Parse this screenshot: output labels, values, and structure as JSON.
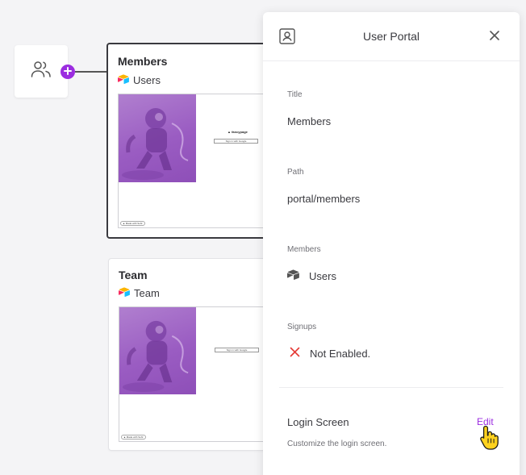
{
  "cards": [
    {
      "title": "Members",
      "source": "Users",
      "preview_logo": "▲ fancypage",
      "preview_button": "Sign in with Google",
      "preview_badge": "▲ Made with Softr"
    },
    {
      "title": "Team",
      "source": "Team",
      "preview_logo": "",
      "preview_button": "Sign in with Google",
      "preview_badge": "▲ Made with Softr"
    }
  ],
  "panel": {
    "title": "User Portal",
    "fields": {
      "title_label": "Title",
      "title_value": "Members",
      "path_label": "Path",
      "path_value": "portal/members",
      "members_label": "Members",
      "members_value": "Users",
      "signups_label": "Signups",
      "signups_value": "Not Enabled."
    },
    "login": {
      "title": "Login Screen",
      "edit_label": "Edit",
      "description": "Customize the login screen."
    }
  },
  "colors": {
    "accent": "#9b2de0",
    "disabled_x": "#e53935",
    "preview_art": "#9a5cc2"
  },
  "icons": {
    "users_node": "users-icon",
    "add": "plus-icon",
    "source": "airtable-icon",
    "portal": "user-portal-icon",
    "close": "close-icon",
    "members_source": "airtable-mono-icon",
    "signups_status": "x-icon",
    "cursor": "pointer-hand-icon"
  }
}
